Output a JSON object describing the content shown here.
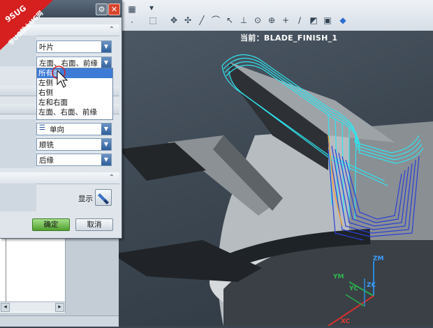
{
  "logo": {
    "line1": "9SUG",
    "line2": "学UG就上UG网"
  },
  "view": {
    "current_label": "当前：",
    "current_value": "BLADE_FINISH_1"
  },
  "dialog": {
    "dropdown1": {
      "value": "叶片"
    },
    "dropdown2": {
      "value": "左面、右面、前缘"
    },
    "dropdown2_options": [
      {
        "label": "所有面",
        "selected": true
      },
      {
        "label": "左侧"
      },
      {
        "label": "右侧"
      },
      {
        "label": "左和右面"
      },
      {
        "label": "左面、右面、前缘"
      }
    ],
    "dropdown3": {
      "value": "单向"
    },
    "dropdown4": {
      "value": "顺铣"
    },
    "dropdown5": {
      "value": "后缘"
    },
    "show_label": "显示",
    "ok_label": "确定",
    "cancel_label": "取消"
  },
  "axes": {
    "zm": "ZM",
    "ym": "YM",
    "zc": "ZC",
    "yc": "YC",
    "xc": "XC"
  },
  "colors": {
    "toolpath_cyan": "#2ee6f0",
    "toolpath_blue": "#2a3fd6",
    "dialog_ok": "#6cc04a",
    "selection": "#3d7bd6",
    "logo_red": "#d61f1f"
  }
}
